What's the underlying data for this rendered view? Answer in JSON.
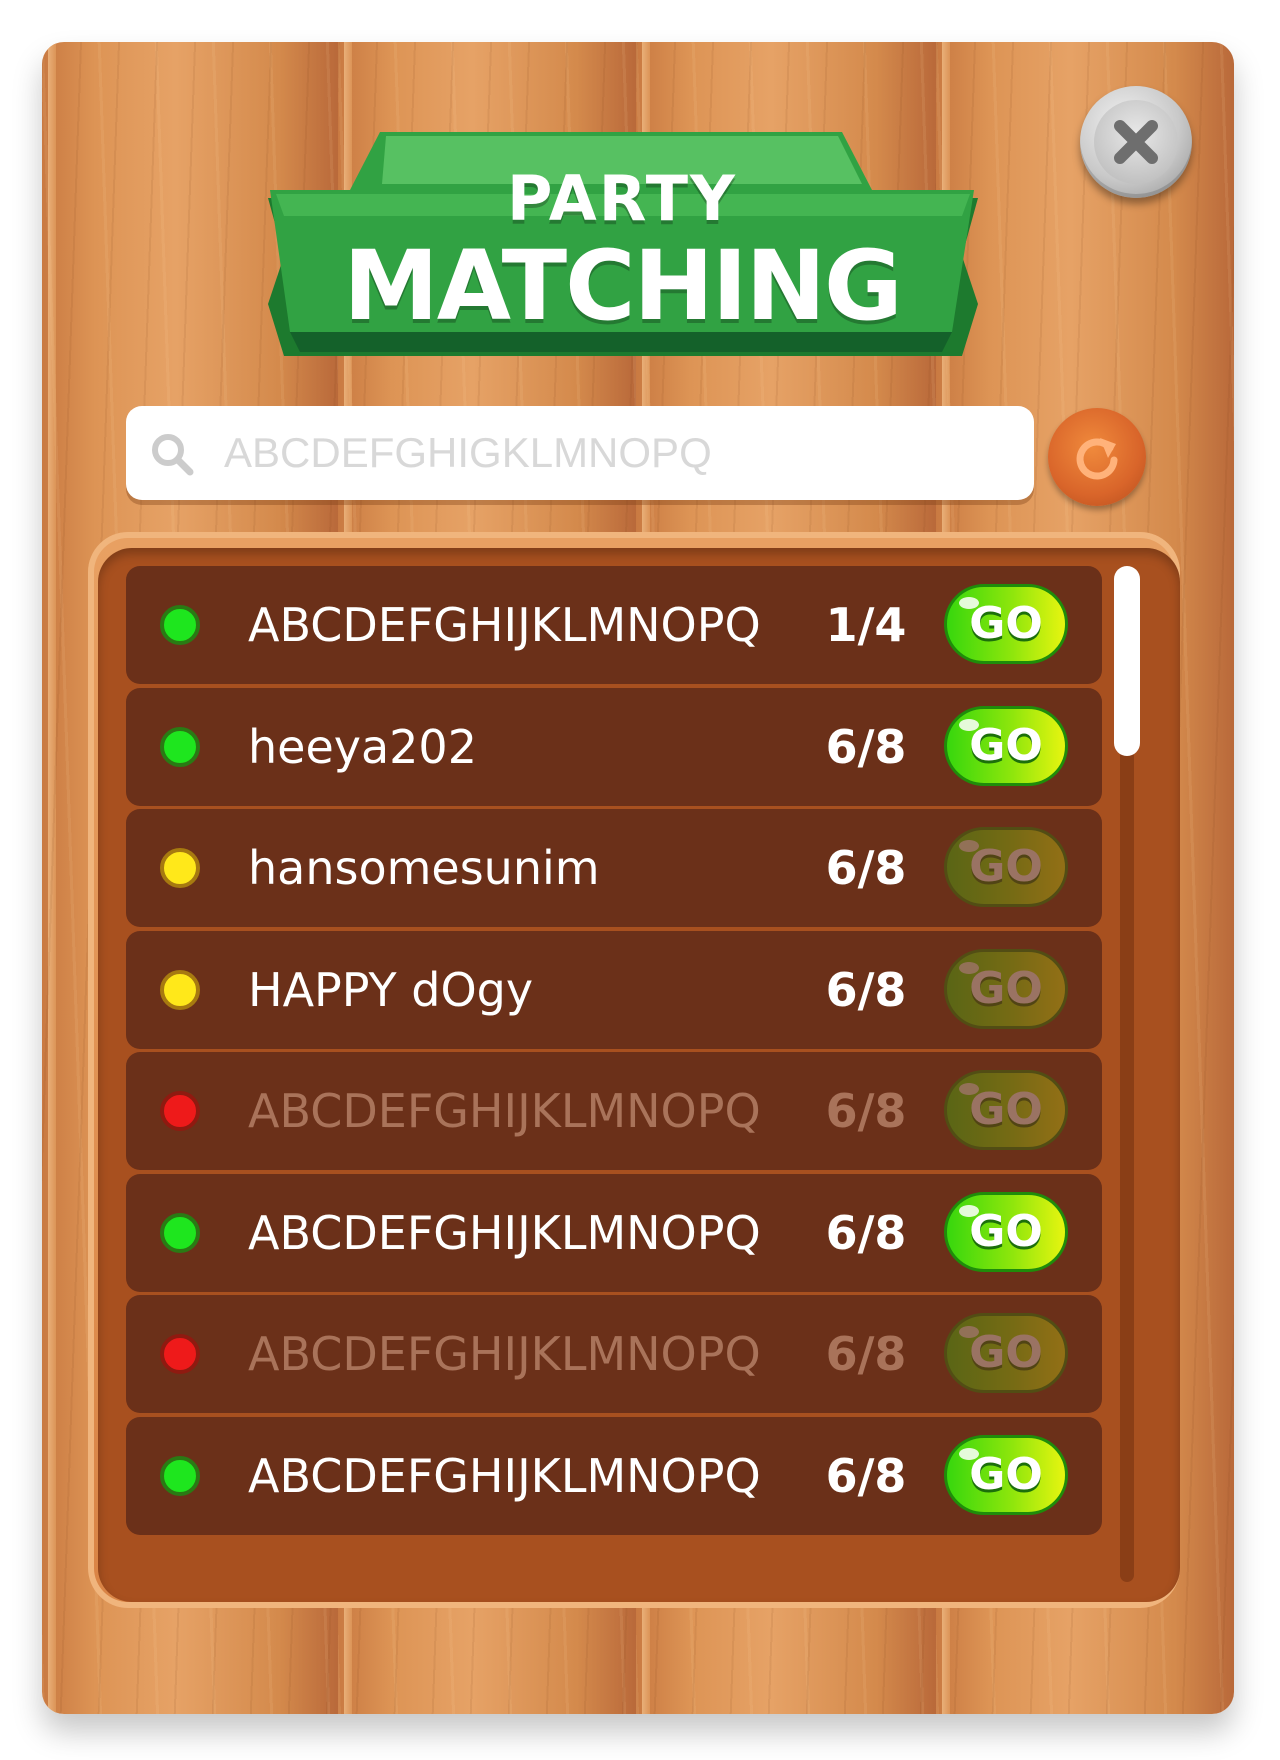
{
  "title": {
    "line1": "PARTY",
    "line2": "MATCHING"
  },
  "search": {
    "placeholder": "ABCDEFGHIGKLMNOPQ"
  },
  "go_label": "GO",
  "colors": {
    "status_green": "#1ee61e",
    "status_yellow": "#ffe81a",
    "status_red": "#ee1a1a",
    "row_bg": "#6b3019",
    "banner_green": "#2f9e3f"
  },
  "parties": [
    {
      "name": "ABCDEFGHIJKLMNOPQ",
      "count": "1/4",
      "status": "green",
      "go_enabled": true
    },
    {
      "name": "heeya202",
      "count": "6/8",
      "status": "green",
      "go_enabled": true
    },
    {
      "name": "hansomesunim",
      "count": "6/8",
      "status": "yellow",
      "go_enabled": false
    },
    {
      "name": "HAPPY dOgy",
      "count": "6/8",
      "status": "yellow",
      "go_enabled": false
    },
    {
      "name": "ABCDEFGHIJKLMNOPQ",
      "count": "6/8",
      "status": "red",
      "go_enabled": false
    },
    {
      "name": "ABCDEFGHIJKLMNOPQ",
      "count": "6/8",
      "status": "green",
      "go_enabled": true
    },
    {
      "name": "ABCDEFGHIJKLMNOPQ",
      "count": "6/8",
      "status": "red",
      "go_enabled": false
    },
    {
      "name": "ABCDEFGHIJKLMNOPQ",
      "count": "6/8",
      "status": "green",
      "go_enabled": true
    }
  ]
}
